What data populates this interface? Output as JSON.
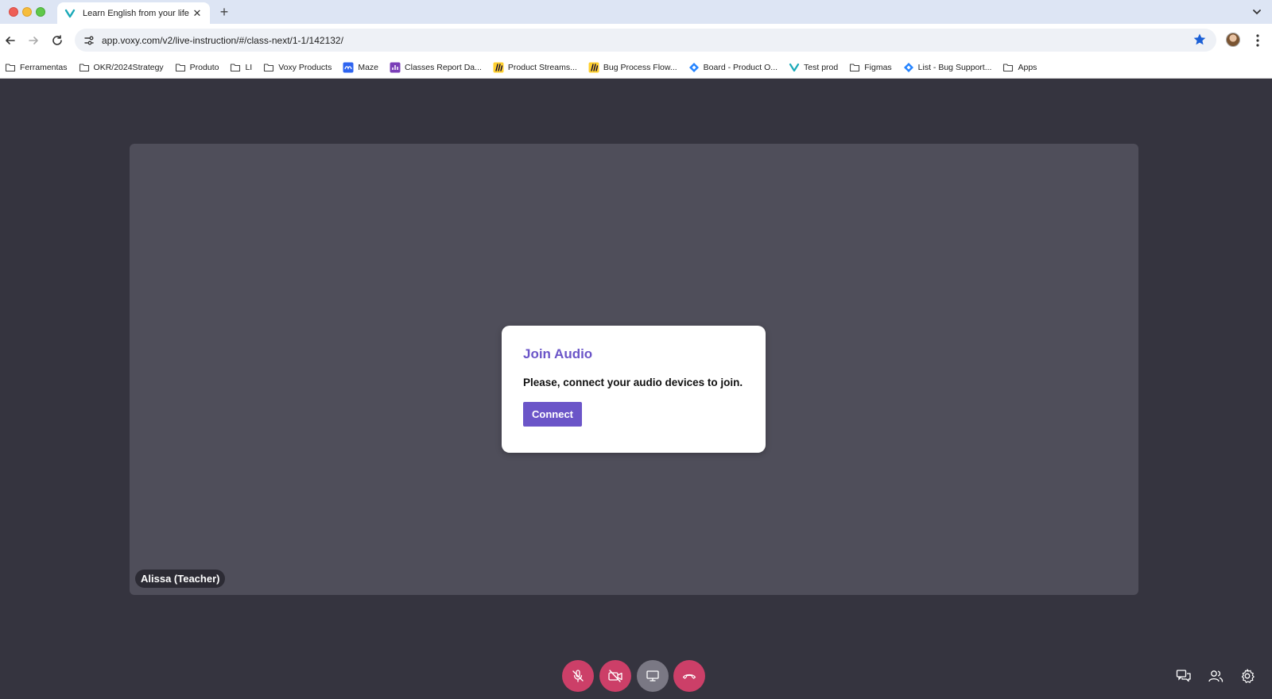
{
  "browser": {
    "tab_title": "Learn English from your life",
    "url": "app.voxy.com/v2/live-instruction/#/class-next/1-1/142132/",
    "bookmarks": [
      {
        "label": "Ferramentas",
        "icon": "folder-icon"
      },
      {
        "label": "OKR/2024Strategy",
        "icon": "folder-icon"
      },
      {
        "label": "Produto",
        "icon": "folder-icon"
      },
      {
        "label": "LI",
        "icon": "folder-icon"
      },
      {
        "label": "Voxy Products",
        "icon": "folder-icon"
      },
      {
        "label": "Maze",
        "icon": "maze-icon"
      },
      {
        "label": "Classes Report Da...",
        "icon": "report-icon"
      },
      {
        "label": "Product Streams...",
        "icon": "miro-icon"
      },
      {
        "label": "Bug Process Flow...",
        "icon": "miro-icon"
      },
      {
        "label": "Board - Product O...",
        "icon": "jira-icon"
      },
      {
        "label": "Test prod",
        "icon": "voxy-icon"
      },
      {
        "label": "Figmas",
        "icon": "folder-icon"
      },
      {
        "label": "List - Bug Support...",
        "icon": "jira-icon"
      },
      {
        "label": "Apps",
        "icon": "folder-icon"
      }
    ]
  },
  "stage": {
    "participant_name": "Alissa (Teacher)"
  },
  "dialog": {
    "title": "Join Audio",
    "message": "Please, connect your audio devices to join.",
    "connect_label": "Connect"
  },
  "controls": {
    "mic_state": "muted",
    "camera_state": "off"
  },
  "colors": {
    "accent": "#6b55c8",
    "danger": "#cc3f68",
    "background": "#35343f",
    "stage": "#4f4e5a"
  }
}
